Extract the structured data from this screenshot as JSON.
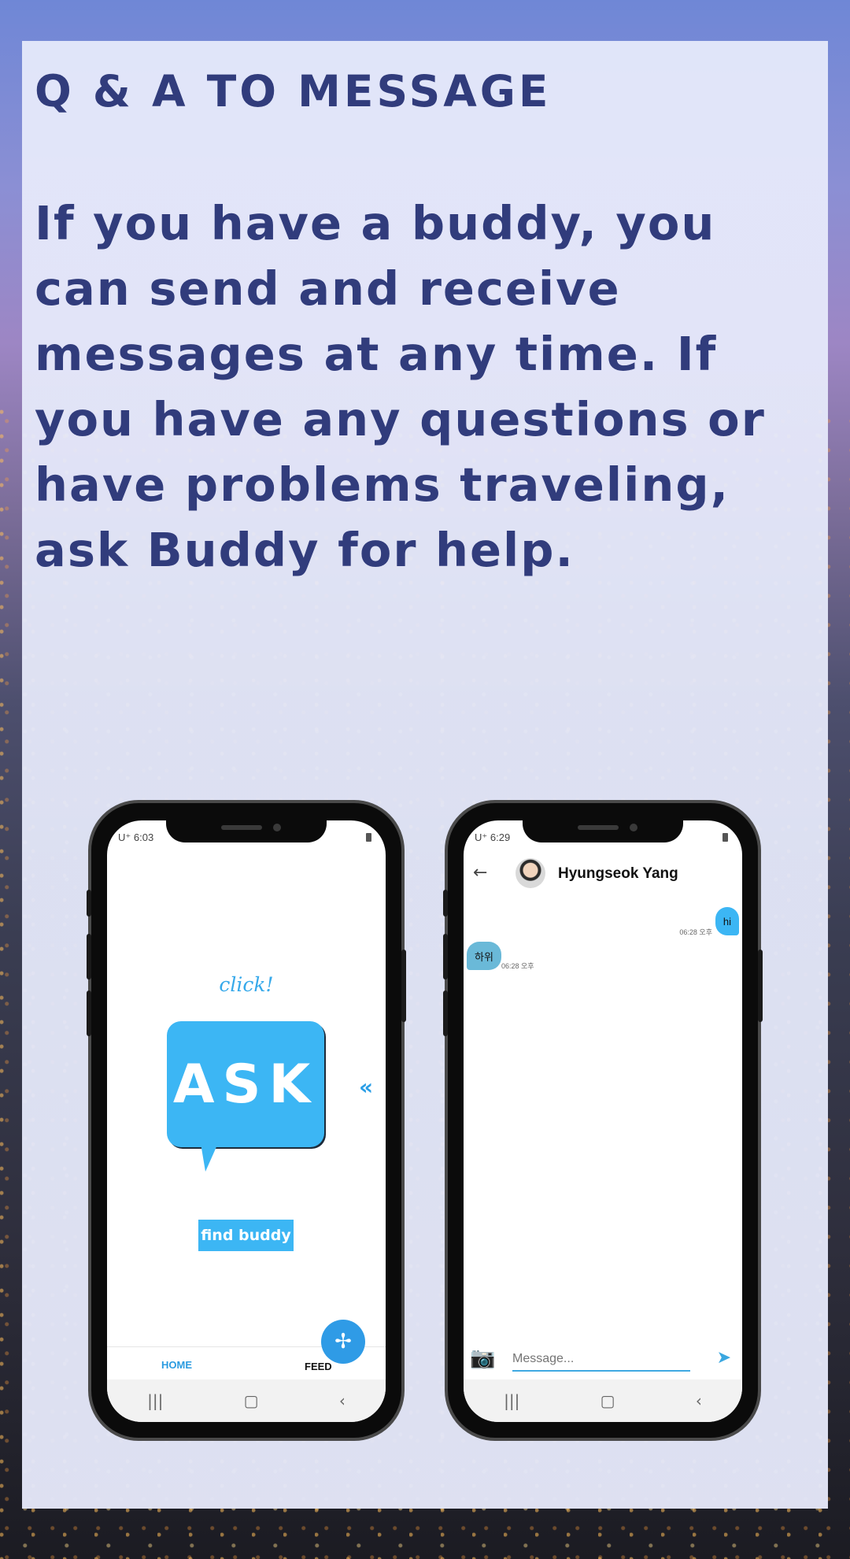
{
  "page": {
    "heading": "Q & A TO MESSAGE",
    "body": "If you have a buddy, you can send and receive messages at any time. If you have any questions or have problems traveling, ask Buddy for help.",
    "colors": {
      "heading": "#313c7c",
      "accent": "#3cb6f4",
      "panel": "#e8ecfc"
    }
  },
  "phone_left": {
    "status_time": "6:03",
    "carrier": "U⁺",
    "click_label": "click!",
    "ask_label": "ASK",
    "chevron": "«",
    "find_buddy_label": "find buddy",
    "fab_icon": "pinwheel-icon",
    "tabs": [
      {
        "label": "HOME",
        "active": true
      },
      {
        "label": "FEED",
        "active": false
      }
    ],
    "nav": {
      "recents": "|||",
      "home": "▢",
      "back": "‹"
    }
  },
  "phone_right": {
    "status_time": "6:29",
    "carrier": "U⁺",
    "contact_name": "Hyungseok Yang",
    "messages": [
      {
        "from": "me",
        "text": "hi",
        "time": "06:28 오후"
      },
      {
        "from": "other",
        "text": "하위",
        "time": "06:28 오후"
      }
    ],
    "composer_placeholder": "Message...",
    "nav": {
      "recents": "|||",
      "home": "▢",
      "back": "‹"
    }
  }
}
